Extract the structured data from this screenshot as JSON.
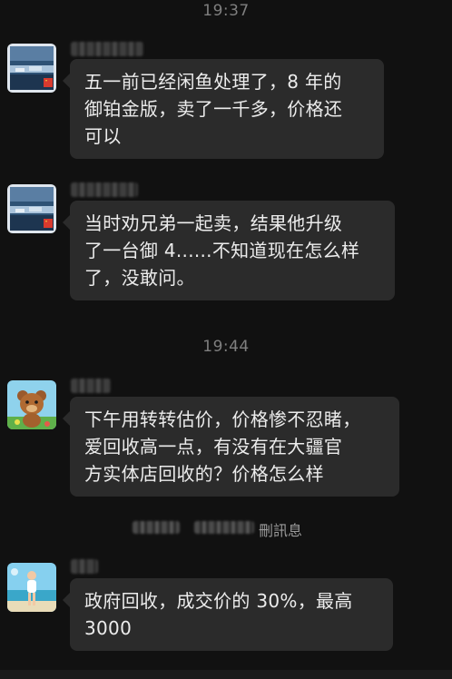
{
  "timestamps": [
    "19:37",
    "19:44"
  ],
  "messages": [
    {
      "avatar": "sky-avatar",
      "lines": [
        "五一前已经闲鱼处理了，8 年的",
        "御铂金版，卖了一千多，价格还",
        "可以"
      ]
    },
    {
      "avatar": "sky-avatar",
      "lines": [
        "当时劝兄弟一起卖，结果他升级",
        "了一台御 4......不知道现在怎么样",
        "了，没敢问。"
      ]
    },
    {
      "avatar": "bear-avatar",
      "lines": [
        "下午用转转估价，价格惨不忍睹，",
        "爱回收高一点，有没有在大疆官",
        "方实体店回收的？价格怎么样"
      ]
    },
    {
      "avatar": "beach-avatar",
      "lines": [
        "政府回收，成交价的 30%，最高",
        "3000"
      ]
    }
  ],
  "system_notice": {
    "text": "刪訊息"
  }
}
